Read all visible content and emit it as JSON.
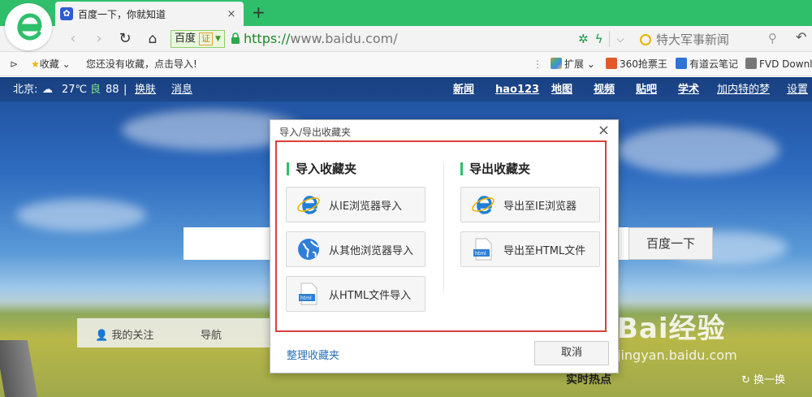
{
  "tab": {
    "title": "百度一下，你就知道",
    "favicon": "baidu-paw-icon",
    "close": "×",
    "new_tab": "+"
  },
  "address": {
    "identity": "百度",
    "cert_badge": "证",
    "url_protocol": "https://",
    "url_rest": "www.baidu.com/",
    "search_placeholder": "特大军事新闻"
  },
  "bookmarks_bar": {
    "favorites": "收藏",
    "empty_hint": "您还没有收藏，点击导入!",
    "extensions": "扩展",
    "ext_items": [
      "360抢票王",
      "有道云笔记",
      "FVD Downl"
    ]
  },
  "page": {
    "weather_city": "北京:",
    "temperature": "27℃",
    "air_quality": "良",
    "aqi": "88",
    "skin": "换肤",
    "messages": "消息",
    "nav_links": [
      "新闻",
      "hao123",
      "地图",
      "视频",
      "贴吧",
      "学术",
      "加内特的梦",
      "设置"
    ],
    "search_button": "百度一下",
    "panel_items": [
      "我的关注",
      "导航"
    ],
    "hot_title": "实时热点",
    "refresh": "换一换",
    "watermark_brand": "Bai经验",
    "watermark_url": "jingyan.baidu.com"
  },
  "dialog": {
    "title": "导入/导出收藏夹",
    "close": "×",
    "import_heading": "导入收藏夹",
    "export_heading": "导出收藏夹",
    "import_options": [
      "从IE浏览器导入",
      "从其他浏览器导入",
      "从HTML文件导入"
    ],
    "export_options": [
      "导出至IE浏览器",
      "导出至HTML文件"
    ],
    "organize_link": "整理收藏夹",
    "cancel": "取消"
  },
  "colors": {
    "accent_green": "#2fbf6b",
    "highlight_red": "#d9403a",
    "link_blue": "#2a6fb8"
  }
}
